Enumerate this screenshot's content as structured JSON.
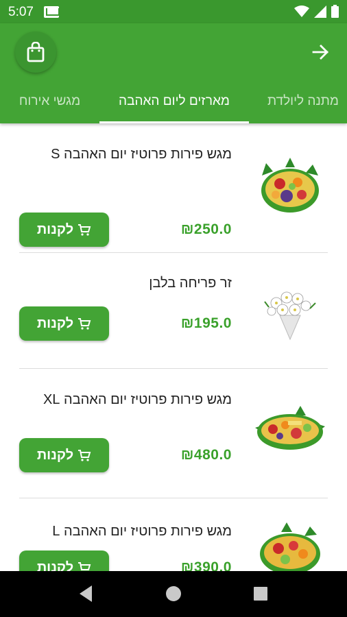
{
  "status": {
    "time": "5:07"
  },
  "tabs": [
    {
      "label": "מתנה ליולדת",
      "active": false
    },
    {
      "label": "מארזים ליום האהבה",
      "active": true
    },
    {
      "label": "מגשי אירוח",
      "active": false
    }
  ],
  "products": [
    {
      "title": "מגש פירות פרוטיז יום האהבה S",
      "price": "₪250.0",
      "buy_label": "לקנות",
      "image": "fruit-platter-round"
    },
    {
      "title": "זר פריחה בלבן",
      "price": "₪195.0",
      "buy_label": "לקנות",
      "image": "white-flower-bouquet"
    },
    {
      "title": "מגש פירות פרוטיז יום האהבה XL",
      "price": "₪480.0",
      "buy_label": "לקנות",
      "image": "fruit-platter-large"
    },
    {
      "title": "מגש פירות פרוטיז יום האהבה L",
      "price": "₪390.0",
      "buy_label": "לקנות",
      "image": "fruit-platter-medium"
    }
  ],
  "colors": {
    "primary": "#43a435",
    "status_bar": "#3a982e",
    "price": "#3aa12b"
  }
}
